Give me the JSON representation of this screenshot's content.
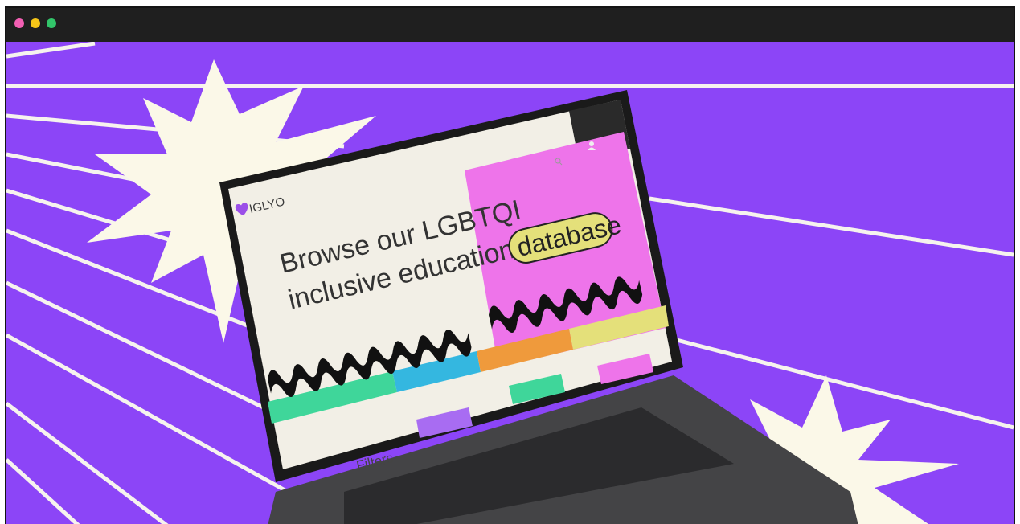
{
  "window": {
    "controls": [
      "close-dot",
      "minimize-dot",
      "maximize-dot"
    ]
  },
  "colors": {
    "background_purple": "#8c45f7",
    "burst_cream": "#fbf8e8",
    "laptop_body": "#3a3a3c",
    "screen_bg": "#f2efe6",
    "accent_pink": "#ee74ea",
    "accent_yellow": "#e4e07a",
    "accent_green": "#3fd69a",
    "accent_blue": "#34b7e0",
    "accent_orange": "#ef9a3c",
    "dot_close": "#f25fb3",
    "dot_minimize": "#f5c518",
    "dot_maximize": "#32c56a"
  },
  "website": {
    "logo_text": "IGLYO",
    "headline_line1": "Browse our LGBTQI",
    "headline_line2": "inclusive education",
    "headline_highlight": "database",
    "filters_label": "Filters"
  },
  "icons": [
    "starburst-left",
    "starburst-right",
    "heart-logo-icon",
    "user-icon",
    "search-icon"
  ]
}
